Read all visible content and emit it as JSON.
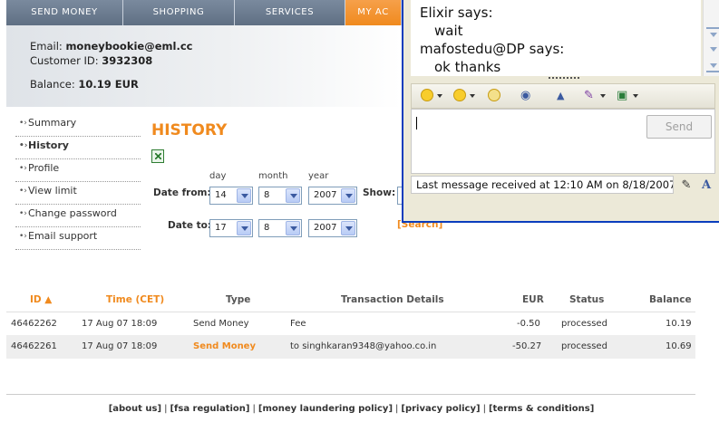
{
  "nav": {
    "tabs": [
      "SEND MONEY",
      "SHOPPING",
      "SERVICES",
      "MY AC"
    ]
  },
  "account": {
    "email_label": "Email:",
    "email": "moneybookie@eml.cc",
    "customer_id_label": "Customer ID:",
    "customer_id": "3932308",
    "balance_label": "Balance:",
    "balance": "10.19 EUR"
  },
  "menu": {
    "items": [
      "Summary",
      "History",
      "Profile",
      "View limit",
      "Change password",
      "Email support"
    ]
  },
  "history": {
    "title": "HISTORY",
    "day_label": "day",
    "month_label": "month",
    "year_label": "year",
    "date_from_label": "Date from:",
    "date_to_label": "Date to:",
    "from": {
      "day": "14",
      "month": "8",
      "year": "2007"
    },
    "to": {
      "day": "17",
      "month": "8",
      "year": "2007"
    },
    "show_label": "Show:",
    "search_label": "[Search]"
  },
  "table": {
    "headers": [
      "ID ▲",
      "Time (CET)",
      "Type",
      "Transaction Details",
      "EUR",
      "Status",
      "Balance"
    ],
    "rows": [
      [
        "46462262",
        "17 Aug 07 18:09",
        "Send Money",
        "Fee",
        "-0.50",
        "processed",
        "10.19"
      ],
      [
        "46462261",
        "17 Aug 07 18:09",
        "Send Money",
        "to singhkaran9348@yahoo.co.in",
        "-50.27",
        "processed",
        "10.69"
      ]
    ]
  },
  "footer": {
    "links": [
      "[about us]",
      "[fsa regulation]",
      "[money laundering policy]",
      "[privacy policy]",
      "[terms & conditions]"
    ],
    "separator": "|"
  },
  "chat": {
    "messages": [
      {
        "sender": "Elixir says:",
        "text": "wait"
      },
      {
        "sender": "mafostedu@DP says:",
        "text": "ok thanks"
      }
    ],
    "send_label": "Send",
    "status": "Last message received at 12:10 AM on 8/18/2007."
  }
}
